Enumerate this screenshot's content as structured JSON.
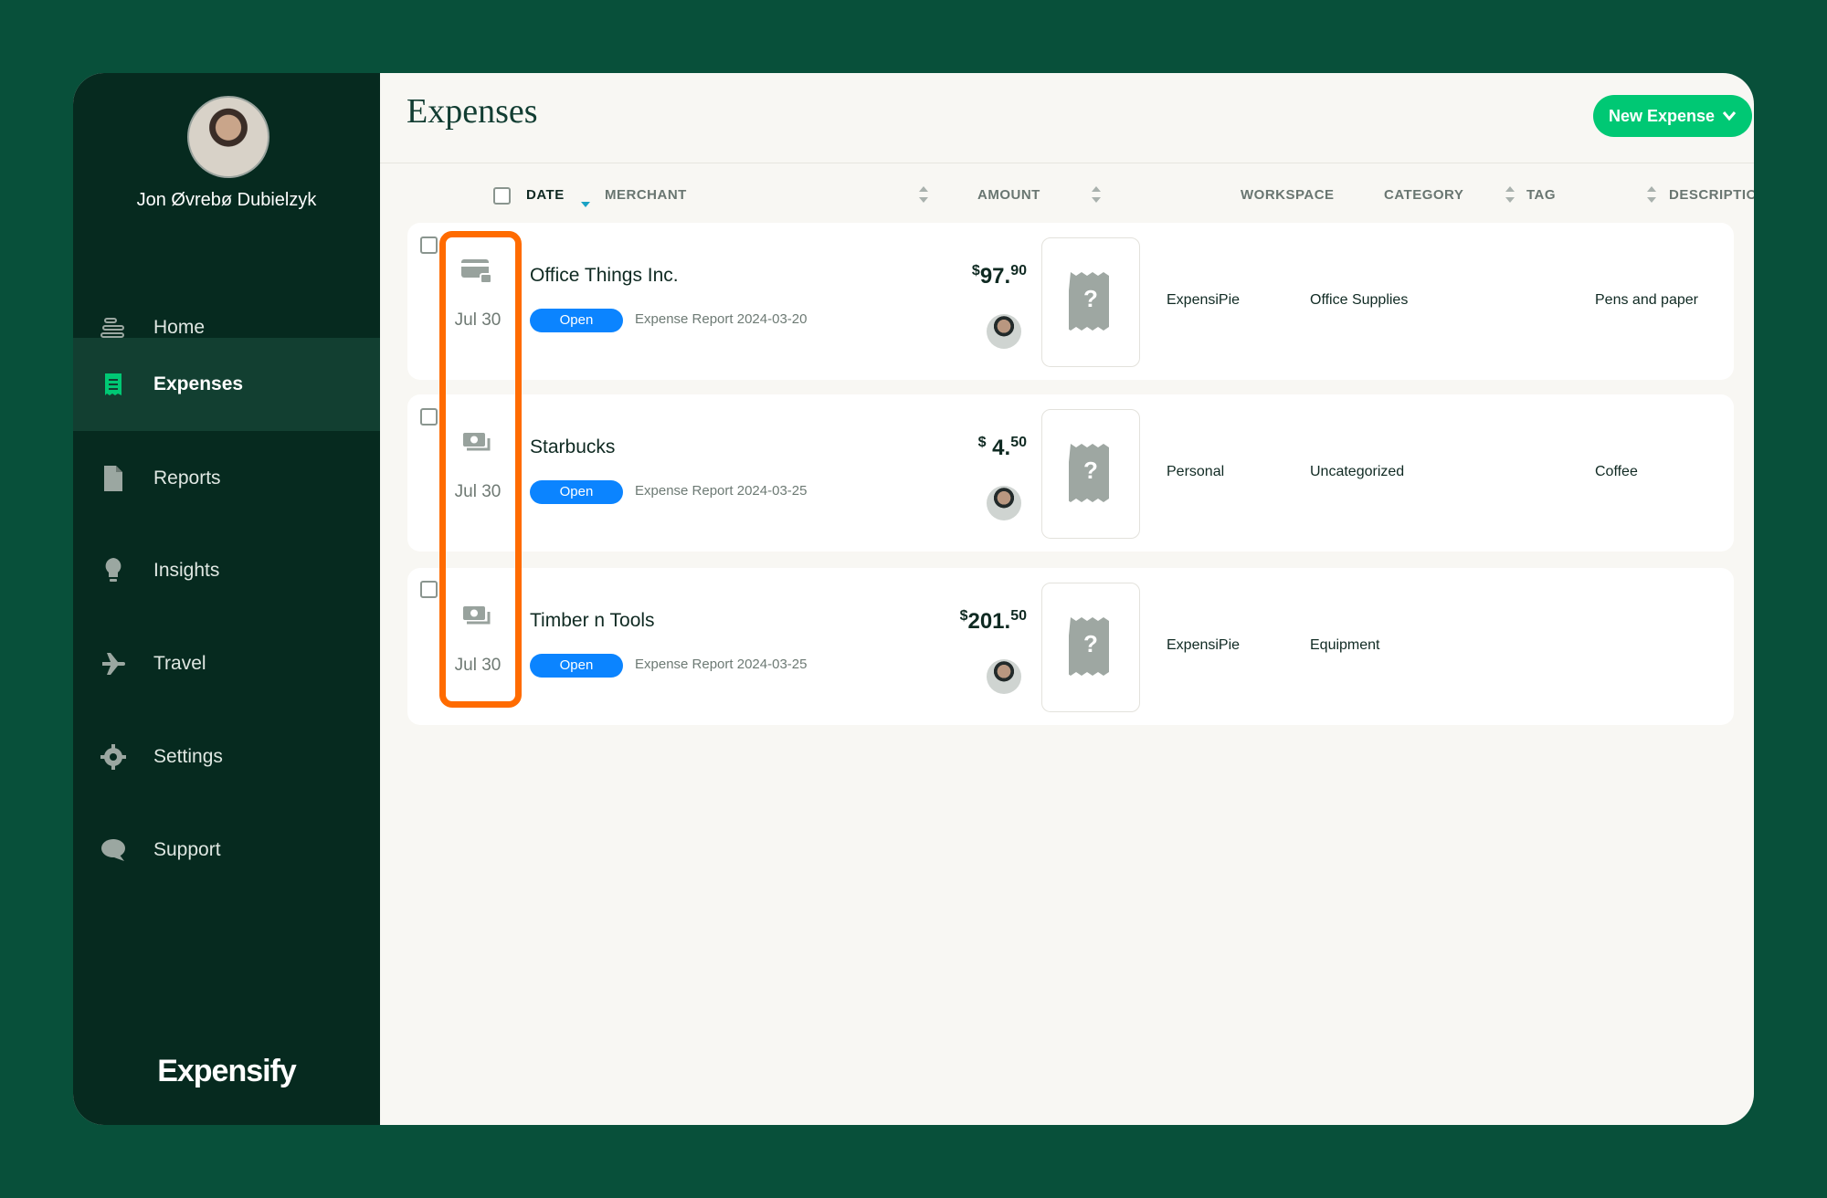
{
  "user": {
    "name": "Jon Øvrebø Dubielzyk"
  },
  "nav": [
    {
      "label": "Home",
      "icon": "home-icon"
    },
    {
      "label": "Expenses",
      "icon": "receipt-icon",
      "active": true
    },
    {
      "label": "Reports",
      "icon": "document-icon"
    },
    {
      "label": "Insights",
      "icon": "lightbulb-icon"
    },
    {
      "label": "Travel",
      "icon": "airplane-icon"
    },
    {
      "label": "Settings",
      "icon": "gear-icon"
    },
    {
      "label": "Support",
      "icon": "chat-icon"
    }
  ],
  "brand": "Expensify",
  "page": {
    "title": "Expenses",
    "new_button": "New Expense"
  },
  "columns": {
    "date": "DATE",
    "merchant": "MERCHANT",
    "amount": "AMOUNT",
    "workspace": "WORKSPACE",
    "category": "CATEGORY",
    "tag": "TAG",
    "description": "DESCRIPTION"
  },
  "expenses": [
    {
      "type_icon": "card-lock-icon",
      "date": "Jul 30",
      "merchant": "Office Things Inc.",
      "status": "Open",
      "report": "Expense Report 2024-03-20",
      "currency": "$",
      "amount_main": "97.",
      "amount_cents": "90",
      "workspace": "ExpensiPie",
      "category": "Office Supplies",
      "tag": "",
      "description": "Pens and paper"
    },
    {
      "type_icon": "cash-icon",
      "date": "Jul 30",
      "merchant": "Starbucks",
      "status": "Open",
      "report": "Expense Report 2024-03-25",
      "currency": "$",
      "amount_main": " 4.",
      "amount_cents": "50",
      "workspace": "Personal",
      "category": "Uncategorized",
      "tag": "",
      "description": "Coffee"
    },
    {
      "type_icon": "cash-icon",
      "date": "Jul 30",
      "merchant": "Timber n Tools",
      "status": "Open",
      "report": "Expense Report 2024-03-25",
      "currency": "$",
      "amount_main": "201.",
      "amount_cents": "50",
      "workspace": "ExpensiPie",
      "category": "Equipment",
      "tag": "",
      "description": ""
    }
  ],
  "colors": {
    "background": "#08503a",
    "sidebar": "#062a1f",
    "accent": "#00c874",
    "badge": "#0b84ff",
    "highlight": "#ff6b00"
  }
}
